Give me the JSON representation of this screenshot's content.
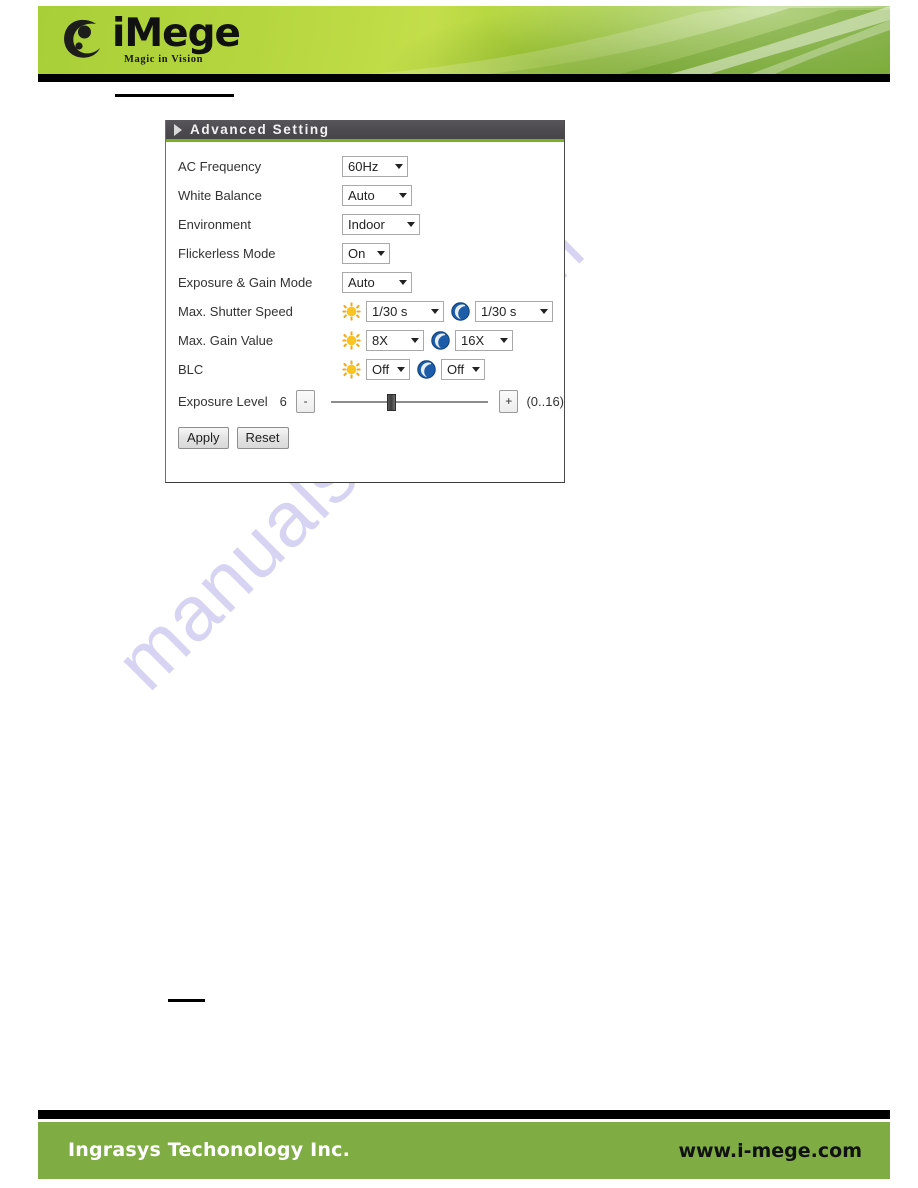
{
  "header": {
    "logo_word": "iMege",
    "logo_tagline": "Magic in Vision",
    "logo_mark_icon": "imege-swoosh-icon"
  },
  "panel": {
    "title": "Advanced Setting",
    "arrow_icon": "triangle-right-icon",
    "rows": [
      {
        "label": "AC Frequency",
        "day_value": "60Hz",
        "night_value": null
      },
      {
        "label": "White Balance",
        "day_value": "Auto",
        "night_value": null
      },
      {
        "label": "Environment",
        "day_value": "Indoor",
        "night_value": null
      },
      {
        "label": "Flickerless Mode",
        "day_value": "On",
        "night_value": null
      },
      {
        "label": "Exposure & Gain Mode",
        "day_value": "Auto",
        "night_value": null
      },
      {
        "label": "Max. Shutter Speed",
        "day_value": "1/30 s",
        "night_value": "1/30 s"
      },
      {
        "label": "Max. Gain Value",
        "day_value": "8X",
        "night_value": "16X"
      },
      {
        "label": "BLC",
        "day_value": "Off",
        "night_value": "Off"
      }
    ],
    "exposure": {
      "label": "Exposure Level",
      "value": "6",
      "decrement_label": "-",
      "increment_label": "+",
      "range_label": "(0..16)",
      "slider_min": 0,
      "slider_max": 16,
      "slider_value": 6
    },
    "buttons": {
      "apply": "Apply",
      "reset": "Reset"
    },
    "icons": {
      "day": "sun-icon",
      "night": "moon-icon"
    }
  },
  "watermark": {
    "text": "manualshive.com"
  },
  "footer": {
    "company": "Ingrasys Techonology Inc.",
    "website": "www.i-mege.com"
  },
  "colors": {
    "banner_green": "#b6d63f",
    "footer_green": "#7fad43",
    "panel_header": "#4c4a4e",
    "panel_accent": "#7cb023",
    "sun": "#f5b81b",
    "moon": "#1f5fa8",
    "watermark": "#c9c6ee"
  }
}
